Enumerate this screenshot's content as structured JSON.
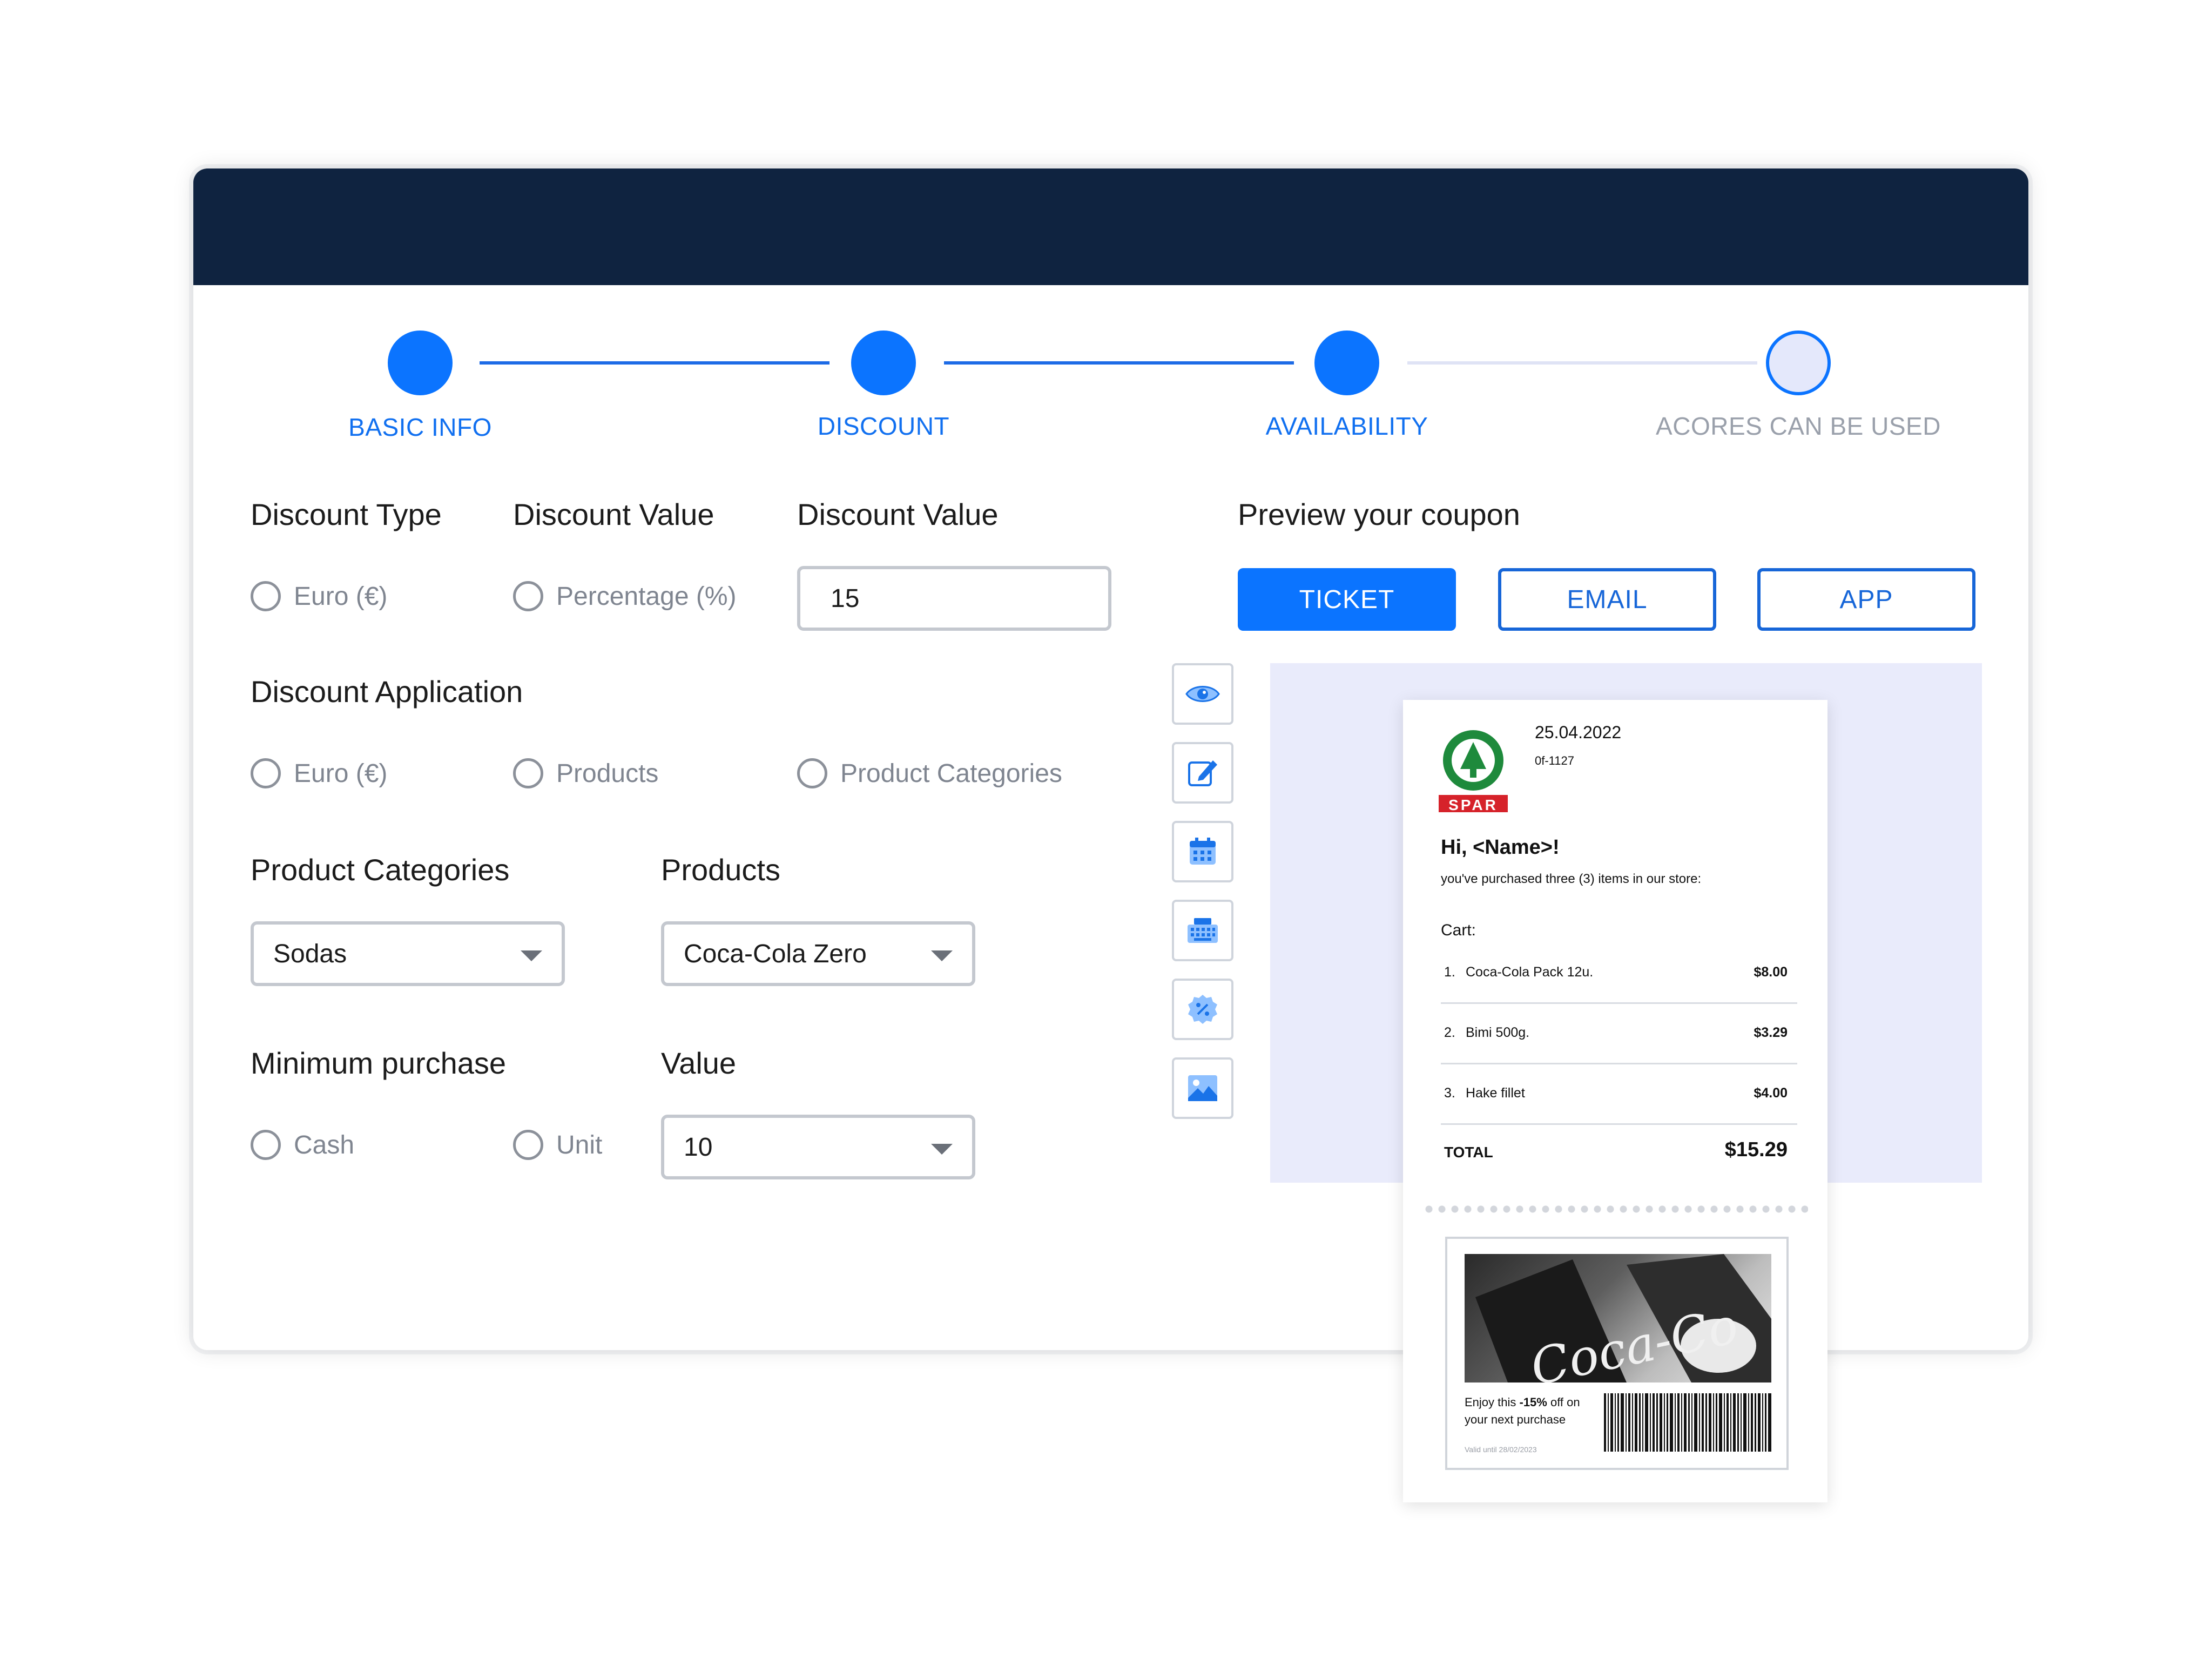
{
  "stepper": {
    "steps": [
      {
        "label": "BASIC INFO",
        "state": "done"
      },
      {
        "label": "DISCOUNT",
        "state": "done"
      },
      {
        "label": "AVAILABILITY",
        "state": "done"
      },
      {
        "label": "ACORES CAN BE USED",
        "state": "todo"
      }
    ]
  },
  "form": {
    "discount_type": {
      "heading": "Discount Type",
      "option": "Euro (€)"
    },
    "discount_value_radio": {
      "heading": "Discount Value",
      "option": "Percentage (%)"
    },
    "discount_value_input": {
      "heading": "Discount Value",
      "value": "15"
    },
    "discount_application": {
      "heading": "Discount Application",
      "options": [
        "Euro (€)",
        "Products",
        "Product Categories"
      ]
    },
    "product_categories": {
      "heading": "Product Categories",
      "selected": "Sodas"
    },
    "products": {
      "heading": "Products",
      "selected": "Coca-Cola Zero"
    },
    "minimum_purchase": {
      "heading": "Minimum purchase",
      "options": [
        "Cash",
        "Unit"
      ]
    },
    "value": {
      "heading": "Value",
      "selected": "10"
    }
  },
  "preview": {
    "heading": "Preview your coupon",
    "buttons": [
      "TICKET",
      "EMAIL",
      "APP"
    ],
    "active": "TICKET"
  },
  "tools": [
    "eye-icon",
    "edit-icon",
    "calendar-icon",
    "keyboard-icon",
    "discount-badge-icon",
    "image-icon"
  ],
  "receipt": {
    "brand": "SPAR",
    "date": "25.04.2022",
    "ref": "0f-1127",
    "greeting": "Hi, <Name>!",
    "subtitle": "you've purchased three (3) items in our store:",
    "cart_label": "Cart:",
    "items": [
      {
        "num": "1.",
        "name": "Coca-Cola Pack 12u.",
        "price": "$8.00"
      },
      {
        "num": "2.",
        "name": "Bimi 500g.",
        "price": "$3.29"
      },
      {
        "num": "3.",
        "name": "Hake fillet",
        "price": "$4.00"
      }
    ],
    "total_label": "TOTAL",
    "total_value": "$15.29",
    "coupon_text_1": "Enjoy this ",
    "coupon_discount": "-15%",
    "coupon_text_2": " off on",
    "coupon_text_3": "your next purchase",
    "valid_until": "Valid until 28/02/2023",
    "image_text": "Coca-Co"
  },
  "colors": {
    "accent": "#0b74ff",
    "header": "#0f2340",
    "preview_bg": "#e9ebfb",
    "spar_green": "#1e8a3c",
    "spar_red": "#d6222a"
  }
}
